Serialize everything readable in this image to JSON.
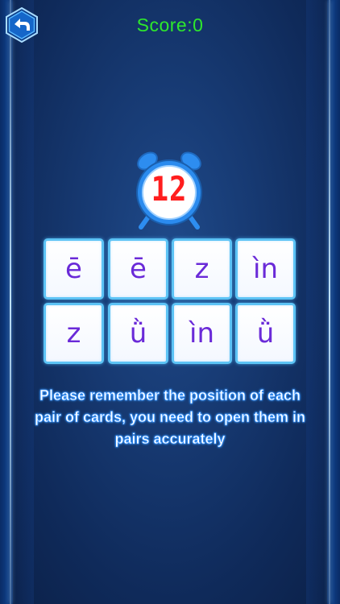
{
  "header": {
    "score_text": "Score:0",
    "back_icon": "back-arrow-icon"
  },
  "timer": {
    "value": "12",
    "icon": "alarm-clock-icon"
  },
  "cards": {
    "row1": [
      "ē",
      "ē",
      "z",
      "ìn"
    ],
    "row2": [
      "z",
      "ǜ",
      "ìn",
      "ǜ"
    ]
  },
  "instructions": "Please remember the position of each pair of cards, you need to open them in pairs accurately",
  "colors": {
    "score": "#2ee82c",
    "timer_digits": "#ff1e1e",
    "card_text": "#6a2ad8",
    "card_border": "#5cc3f5"
  }
}
